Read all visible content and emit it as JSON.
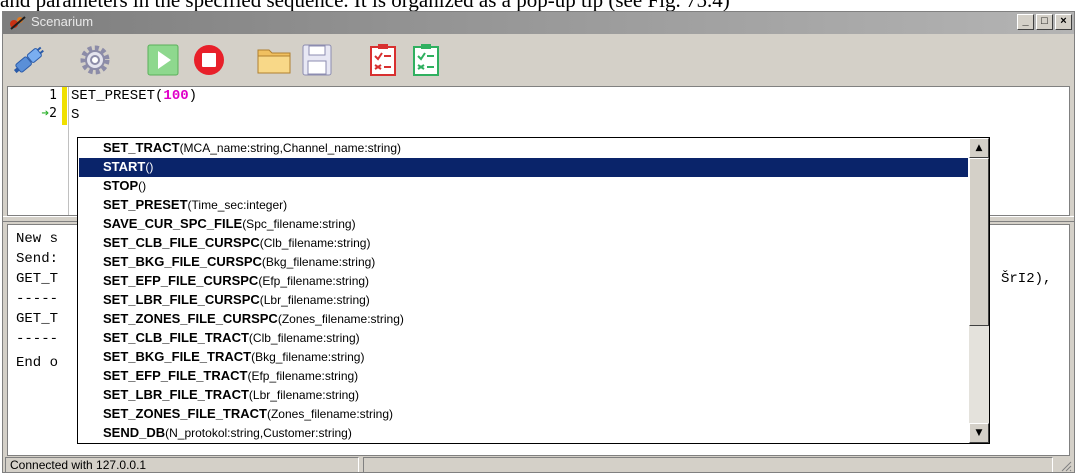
{
  "doc_text": "and parameters in the specified sequence. It is organized as a pop-up tip (see Fig. 75.4)",
  "window": {
    "title": "Scenarium",
    "buttons": {
      "minimize": "_",
      "maximize": "□",
      "close": "×"
    }
  },
  "toolbar": {
    "icons": [
      "connect-icon",
      "settings-icon",
      "run-icon",
      "stop-icon",
      "open-folder-icon",
      "save-icon",
      "checklist-red-icon",
      "checklist-green-icon"
    ]
  },
  "editor": {
    "lines": [
      {
        "num": "1",
        "cmd": "SET_PRESET(",
        "arg": "100",
        "close": ")"
      },
      {
        "num": "2",
        "text": "S"
      }
    ]
  },
  "log": {
    "lines": [
      {
        "left": "New s",
        "right": ""
      },
      {
        "left": "Send:",
        "right": ""
      },
      {
        "left": "GET_T",
        "right": "ŠrI2),"
      },
      {
        "left": "-----",
        "right": ""
      },
      {
        "left": "GET_T",
        "right": ""
      },
      {
        "left": "-----",
        "right": ""
      },
      {
        "left": "End o",
        "right": ""
      }
    ]
  },
  "popup": {
    "items": [
      {
        "name": "SET_TRACT",
        "params": "(MCA_name:string,Channel_name:string)"
      },
      {
        "name": "START",
        "params": "()"
      },
      {
        "name": "STOP",
        "params": "()"
      },
      {
        "name": "SET_PRESET",
        "params": "(Time_sec:integer)"
      },
      {
        "name": "SAVE_CUR_SPC_FILE",
        "params": "(Spc_filename:string)"
      },
      {
        "name": "SET_CLB_FILE_CURSPC",
        "params": "(Clb_filename:string)"
      },
      {
        "name": "SET_BKG_FILE_CURSPC",
        "params": "(Bkg_filename:string)"
      },
      {
        "name": "SET_EFP_FILE_CURSPC",
        "params": "(Efp_filename:string)"
      },
      {
        "name": "SET_LBR_FILE_CURSPC",
        "params": "(Lbr_filename:string)"
      },
      {
        "name": "SET_ZONES_FILE_CURSPC",
        "params": "(Zones_filename:string)"
      },
      {
        "name": "SET_CLB_FILE_TRACT",
        "params": "(Clb_filename:string)"
      },
      {
        "name": "SET_BKG_FILE_TRACT",
        "params": "(Bkg_filename:string)"
      },
      {
        "name": "SET_EFP_FILE_TRACT",
        "params": "(Efp_filename:string)"
      },
      {
        "name": "SET_LBR_FILE_TRACT",
        "params": "(Lbr_filename:string)"
      },
      {
        "name": "SET_ZONES_FILE_TRACT",
        "params": "(Zones_filename:string)"
      },
      {
        "name": "SEND_DB",
        "params": "(N_protokol:string,Customer:string)"
      }
    ],
    "selected_index": 1,
    "scroll_up": "▲",
    "scroll_down": "▼"
  },
  "status": {
    "text": "Connected with 127.0.0.1"
  }
}
